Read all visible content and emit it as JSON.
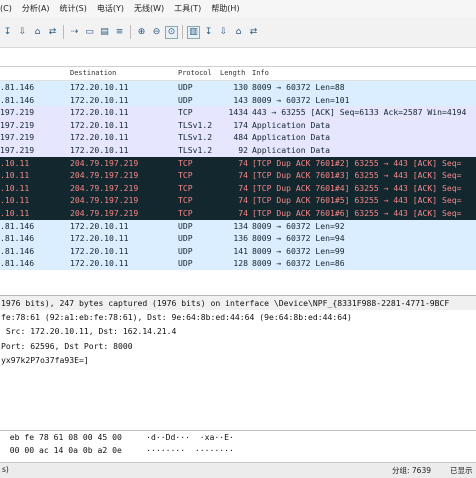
{
  "menu": [
    "(C)",
    "分析(A)",
    "统计(S)",
    "电话(Y)",
    "无线(W)",
    "工具(T)",
    "帮助(H)"
  ],
  "toolbar": {
    "icons": [
      "open-icon",
      "save-icon",
      "close-icon",
      "reload-icon",
      "find-icon",
      "go-back-icon",
      "go-forward-icon",
      "jump-icon",
      "first-packet-icon",
      "last-packet-icon",
      "autoscroll-icon",
      "colorize-icon",
      "zoom-in-icon",
      "zoom-out-icon",
      "zoom-reset-icon",
      "resize-columns-icon"
    ],
    "glyphs": [
      "↧",
      "⇩",
      "⌂",
      "⇄",
      "⇢",
      "▭",
      "▤",
      "≡",
      "⊕",
      "⊖",
      "⊙",
      "▥"
    ]
  },
  "columns": {
    "destination": "Destination",
    "protocol": "Protocol",
    "length": "Length",
    "info": "Info"
  },
  "rows": [
    {
      "src": ".81.146",
      "dst": "172.20.10.11",
      "proto": "UDP",
      "len": "130",
      "info": "8009 → 60372 Len=88",
      "bg": "#daeeff",
      "fg": "#12272e"
    },
    {
      "src": ".81.146",
      "dst": "172.20.10.11",
      "proto": "UDP",
      "len": "143",
      "info": "8009 → 60372 Len=101",
      "bg": "#daeeff",
      "fg": "#12272e"
    },
    {
      "src": "197.219",
      "dst": "172.20.10.11",
      "proto": "TCP",
      "len": "1434",
      "info": "443 → 63255 [ACK] Seq=6133 Ack=2587 Win=4194",
      "bg": "#e7e6ff",
      "fg": "#12272e"
    },
    {
      "src": "197.219",
      "dst": "172.20.10.11",
      "proto": "TLSv1.2",
      "len": "174",
      "info": "Application Data",
      "bg": "#e7e6ff",
      "fg": "#12272e"
    },
    {
      "src": "197.219",
      "dst": "172.20.10.11",
      "proto": "TLSv1.2",
      "len": "484",
      "info": "Application Data",
      "bg": "#e7e6ff",
      "fg": "#12272e"
    },
    {
      "src": "197.219",
      "dst": "172.20.10.11",
      "proto": "TLSv1.2",
      "len": "92",
      "info": "Application Data",
      "bg": "#e7e6ff",
      "fg": "#12272e"
    },
    {
      "src": ".10.11",
      "dst": "204.79.197.219",
      "proto": "TCP",
      "len": "74",
      "info": "[TCP Dup ACK 7601#2] 63255 → 443 [ACK] Seq=",
      "bg": "#12272e",
      "fg": "#f78787"
    },
    {
      "src": ".10.11",
      "dst": "204.79.197.219",
      "proto": "TCP",
      "len": "74",
      "info": "[TCP Dup ACK 7601#3] 63255 → 443 [ACK] Seq=",
      "bg": "#12272e",
      "fg": "#f78787"
    },
    {
      "src": ".10.11",
      "dst": "204.79.197.219",
      "proto": "TCP",
      "len": "74",
      "info": "[TCP Dup ACK 7601#4] 63255 → 443 [ACK] Seq=",
      "bg": "#12272e",
      "fg": "#f78787"
    },
    {
      "src": ".10.11",
      "dst": "204.79.197.219",
      "proto": "TCP",
      "len": "74",
      "info": "[TCP Dup ACK 7601#5] 63255 → 443 [ACK] Seq=",
      "bg": "#12272e",
      "fg": "#f78787"
    },
    {
      "src": ".10.11",
      "dst": "204.79.197.219",
      "proto": "TCP",
      "len": "74",
      "info": "[TCP Dup ACK 7601#6] 63255 → 443 [ACK] Seq=",
      "bg": "#12272e",
      "fg": "#f78787"
    },
    {
      "src": ".81.146",
      "dst": "172.20.10.11",
      "proto": "UDP",
      "len": "134",
      "info": "8009 → 60372 Len=92",
      "bg": "#daeeff",
      "fg": "#12272e"
    },
    {
      "src": ".81.146",
      "dst": "172.20.10.11",
      "proto": "UDP",
      "len": "136",
      "info": "8009 → 60372 Len=94",
      "bg": "#daeeff",
      "fg": "#12272e"
    },
    {
      "src": ".81.146",
      "dst": "172.20.10.11",
      "proto": "UDP",
      "len": "141",
      "info": "8009 → 60372 Len=99",
      "bg": "#daeeff",
      "fg": "#12272e"
    },
    {
      "src": ".81.146",
      "dst": "172.20.10.11",
      "proto": "UDP",
      "len": "128",
      "info": "8009 → 60372 Len=86",
      "bg": "#daeeff",
      "fg": "#12272e"
    }
  ],
  "details": [
    "1976 bits), 247 bytes captured (1976 bits) on interface \\Device\\NPF_{8331F988-2281-4771-9BCF",
    "fe:78:61 (92:a1:eb:fe:78:61), Dst: 9e:64:8b:ed:44:64 (9e:64:8b:ed:44:64)",
    " Src: 172.20.10.11, Dst: 162.14.21.4",
    "Port: 62596, Dst Port: 8000",
    "yx97k2P7o37fa93E=]"
  ],
  "bytes": [
    "  eb fe 78 61 08 00 45 00     ·d··Dd···  ·xa··E·",
    "  00 00 ac 14 0a 0b a2 0e     ········  ········"
  ],
  "status": {
    "left": "s)",
    "packets_label": "分组: 7639",
    "right": "已显示"
  }
}
